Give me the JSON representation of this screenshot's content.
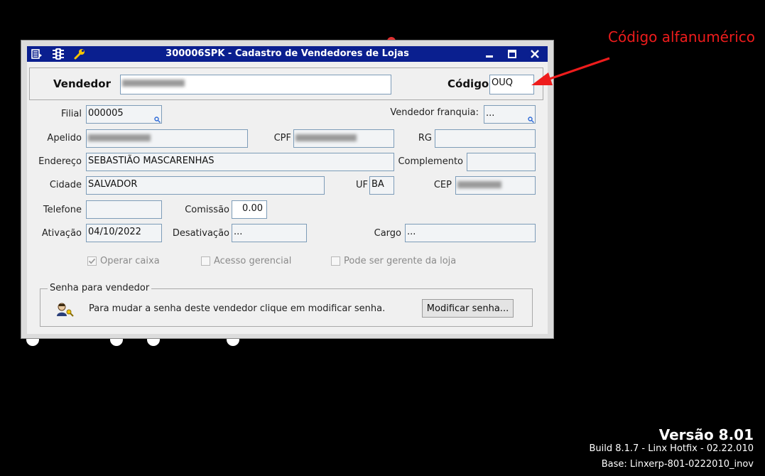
{
  "window": {
    "title": "300006SPK - Cadastro de Vendedores de Lojas"
  },
  "header": {
    "vendedor_label": "Vendedor",
    "codigo_label": "Código",
    "codigo_value": "OUQ"
  },
  "form": {
    "filial_label": "Filial",
    "filial_value": "000005",
    "vendedor_franquia_label": "Vendedor franquia:",
    "vendedor_franquia_value": "...",
    "apelido_label": "Apelido",
    "cpf_label": "CPF",
    "rg_label": "RG",
    "endereco_label": "Endereço",
    "endereco_value": "SEBASTIÃO MASCARENHAS",
    "complemento_label": "Complemento",
    "cidade_label": "Cidade",
    "cidade_value": "SALVADOR",
    "uf_label": "UF",
    "uf_value": "BA",
    "cep_label": "CEP",
    "telefone_label": "Telefone",
    "comissao_label": "Comissão",
    "comissao_value": "0.00",
    "ativacao_label": "Ativação",
    "ativacao_value": "04/10/2022",
    "desativacao_label": "Desativação",
    "desativacao_value": "...",
    "cargo_label": "Cargo",
    "cargo_value": "..."
  },
  "checks": {
    "operar_caixa": "Operar caixa",
    "operar_caixa_checked": true,
    "acesso_gerencial": "Acesso gerencial",
    "acesso_gerencial_checked": false,
    "gerente_loja": "Pode ser gerente da loja",
    "gerente_loja_checked": false
  },
  "senha": {
    "legend": "Senha para vendedor",
    "text": "Para mudar a senha deste vendedor clique em modificar senha.",
    "button": "Modificar senha..."
  },
  "annotation": {
    "text": "Código alfanumérico",
    "color": "#ee1c1c"
  },
  "footer": {
    "version": "Versão  8.01",
    "build": "Build 8.1.7 - Linx Hotfix - 02.22.010",
    "base": "Base: Linxerp-801-0222010_inov"
  },
  "colors": {
    "titlebar": "#0a1f8f",
    "field_border": "#7d9cb8"
  }
}
